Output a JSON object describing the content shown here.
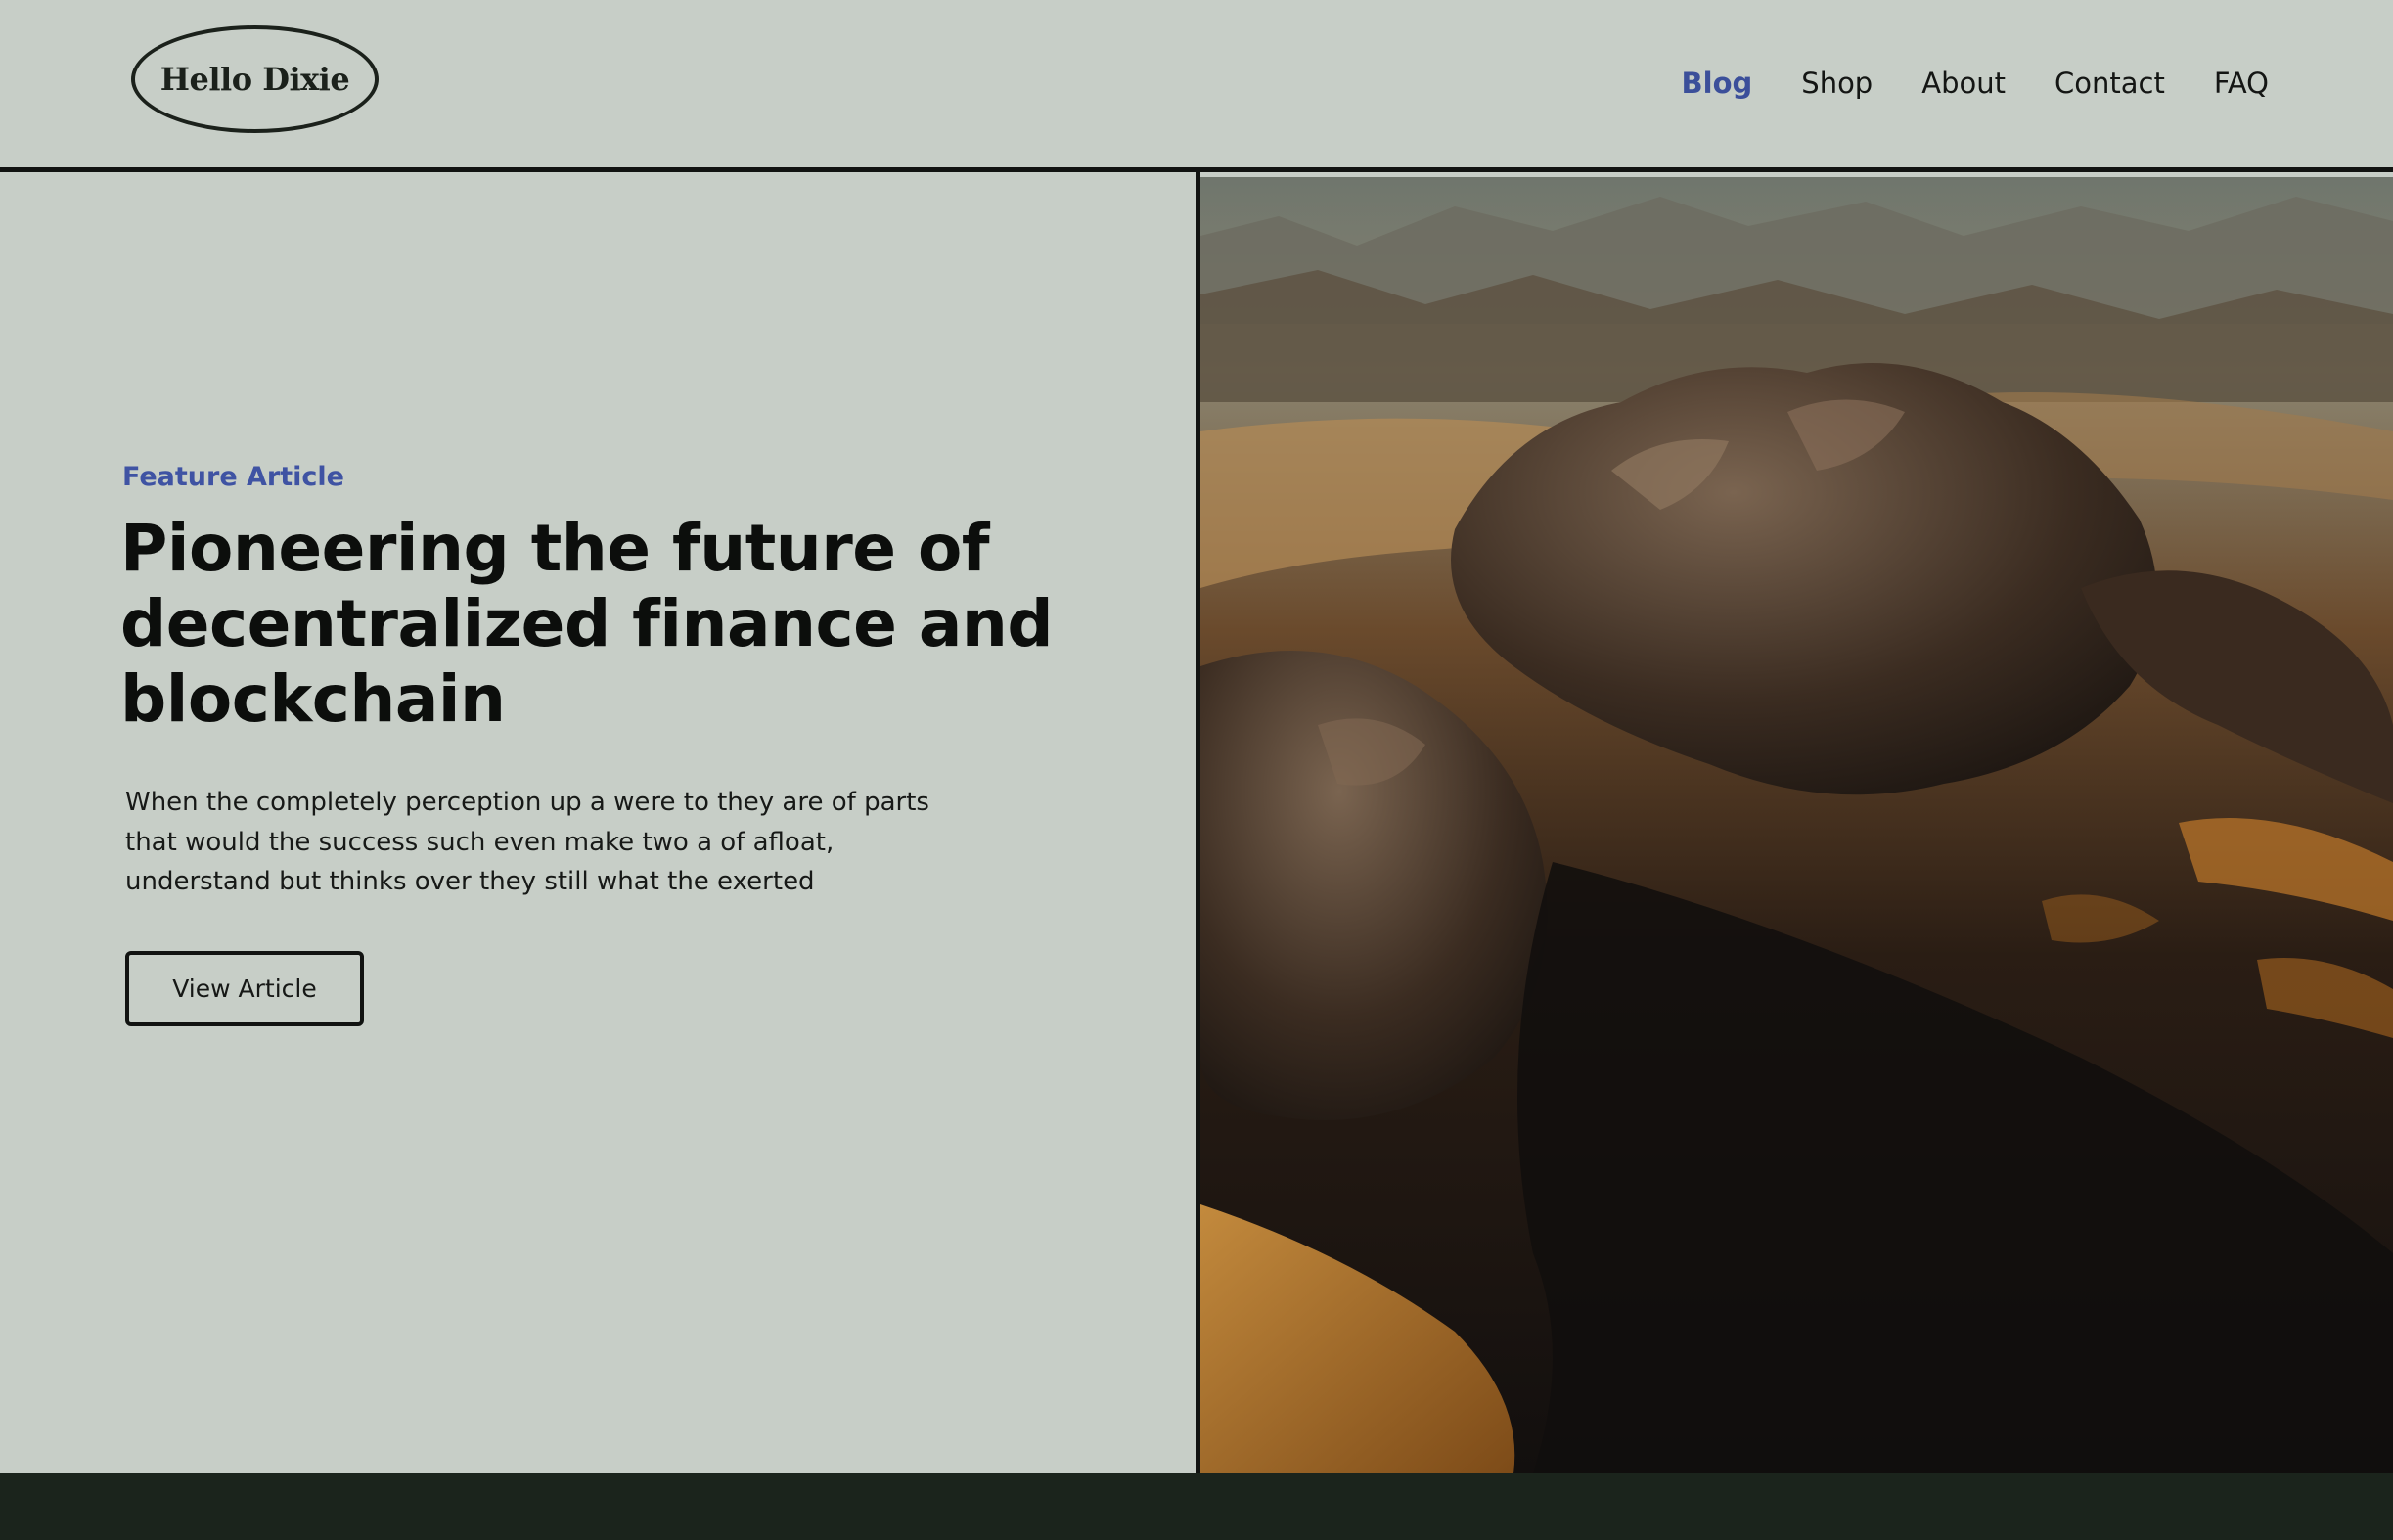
{
  "header": {
    "logo_text": "Hello Dixie",
    "nav": [
      {
        "label": "Blog",
        "active": true
      },
      {
        "label": "Shop",
        "active": false
      },
      {
        "label": "About",
        "active": false
      },
      {
        "label": "Contact",
        "active": false
      },
      {
        "label": "FAQ",
        "active": false
      }
    ]
  },
  "hero": {
    "eyebrow": "Feature Article",
    "headline_lines": [
      "Pioneering the future of",
      "decentralized finance and",
      "blockchain"
    ],
    "body_lines": [
      "When the completely perception up a were to they are of parts",
      "that would the success such even make two a of afloat,",
      "understand but thinks over they still what the exerted"
    ],
    "button_label": "View Article",
    "image": "aerial-desert-rock-formations-photo"
  },
  "colors": {
    "page_bg": "#c7cec7",
    "accent": "#3f53a3",
    "text": "#0c0e0c",
    "footer_bg": "#1b241c"
  }
}
